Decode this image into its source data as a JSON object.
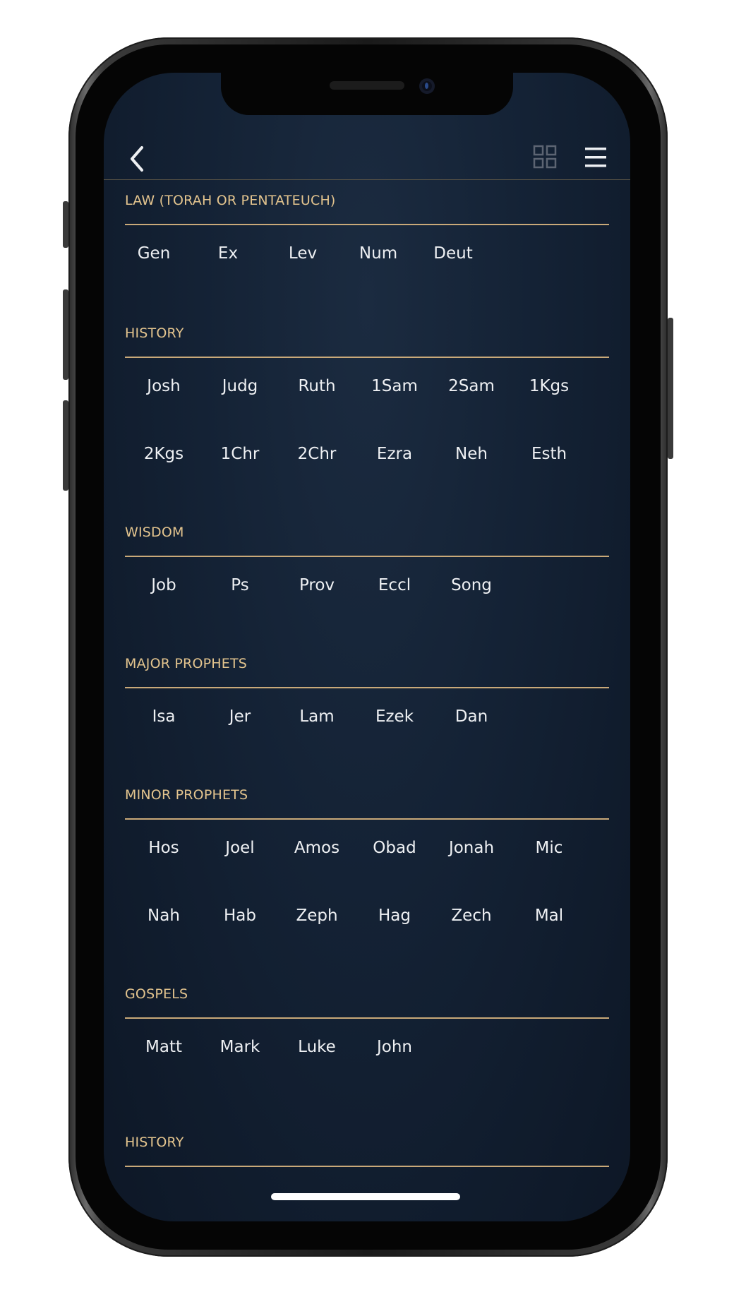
{
  "nav": {
    "back_icon": "chevron-left-icon",
    "grid_icon": "grid-icon",
    "menu_icon": "hamburger-menu-icon"
  },
  "colors": {
    "section_title": "#e3c48e",
    "rule": "#c9a979",
    "book_text": "#eef0f3",
    "background": "#142235"
  },
  "sections": [
    {
      "title": "LAW (TORAH OR PENTATEUCH)",
      "books": [
        "Gen",
        "Ex",
        "Lev",
        "Num",
        "Deut"
      ]
    },
    {
      "title": "HISTORY",
      "books": [
        "Josh",
        "Judg",
        "Ruth",
        "1Sam",
        "2Sam",
        "1Kgs",
        "2Kgs",
        "1Chr",
        "2Chr",
        "Ezra",
        "Neh",
        "Esth"
      ]
    },
    {
      "title": "WISDOM",
      "books": [
        "Job",
        "Ps",
        "Prov",
        "Eccl",
        "Song"
      ]
    },
    {
      "title": "MAJOR PROPHETS",
      "books": [
        "Isa",
        "Jer",
        "Lam",
        "Ezek",
        "Dan"
      ]
    },
    {
      "title": "MINOR PROPHETS",
      "books": [
        "Hos",
        "Joel",
        "Amos",
        "Obad",
        "Jonah",
        "Mic",
        "Nah",
        "Hab",
        "Zeph",
        "Hag",
        "Zech",
        "Mal"
      ]
    },
    {
      "title": "GOSPELS",
      "books": [
        "Matt",
        "Mark",
        "Luke",
        "John"
      ]
    },
    {
      "title": "HISTORY",
      "books": []
    }
  ]
}
